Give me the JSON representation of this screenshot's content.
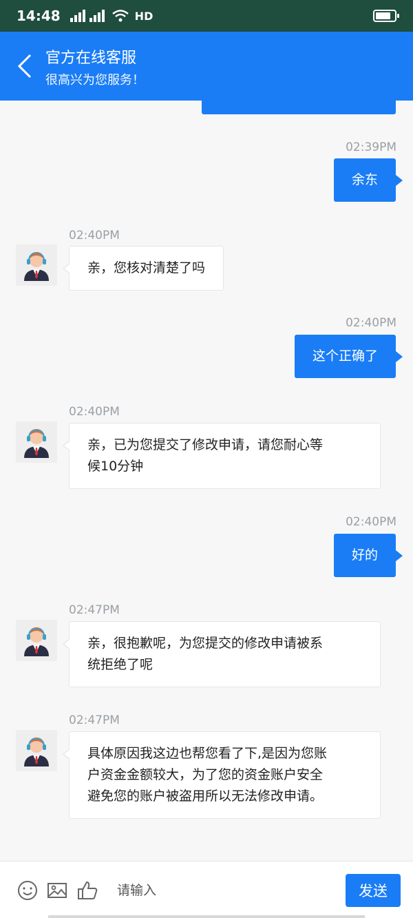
{
  "status_bar": {
    "time": "14:48",
    "network_label": "HD",
    "battery_level": 0.8
  },
  "header": {
    "title": "官方在线客服",
    "subtitle": "很高兴为您服务！"
  },
  "messages": [
    {
      "direction": "outgoing",
      "time": "02:39PM",
      "text": "余东"
    },
    {
      "direction": "incoming",
      "time": "02:40PM",
      "text": "亲，您核对清楚了吗"
    },
    {
      "direction": "outgoing",
      "time": "02:40PM",
      "text": "这个正确了"
    },
    {
      "direction": "incoming",
      "time": "02:40PM",
      "lines": [
        "亲，已为您提交了修改申请，请您耐心等",
        "候10分钟"
      ]
    },
    {
      "direction": "outgoing",
      "time": "02:40PM",
      "text": "好的"
    },
    {
      "direction": "incoming",
      "time": "02:47PM",
      "lines": [
        "亲，很抱歉呢，为您提交的修改申请被系",
        "统拒绝了呢"
      ]
    },
    {
      "direction": "incoming",
      "time": "02:47PM",
      "lines": [
        "具体原因我这边也帮您看了下,是因为您账",
        "户资金金额较大，为了您的资金账户安全",
        "避免您的账户被盗用所以无法修改申请。"
      ]
    }
  ],
  "input_bar": {
    "icons": [
      "emoji-icon",
      "image-icon",
      "thumbs-up-icon"
    ],
    "placeholder": "请输入",
    "send_label": "发送"
  },
  "colors": {
    "accent": "#1a7df6",
    "status_bar": "#1f4d3e",
    "background": "#f7f7f7"
  }
}
